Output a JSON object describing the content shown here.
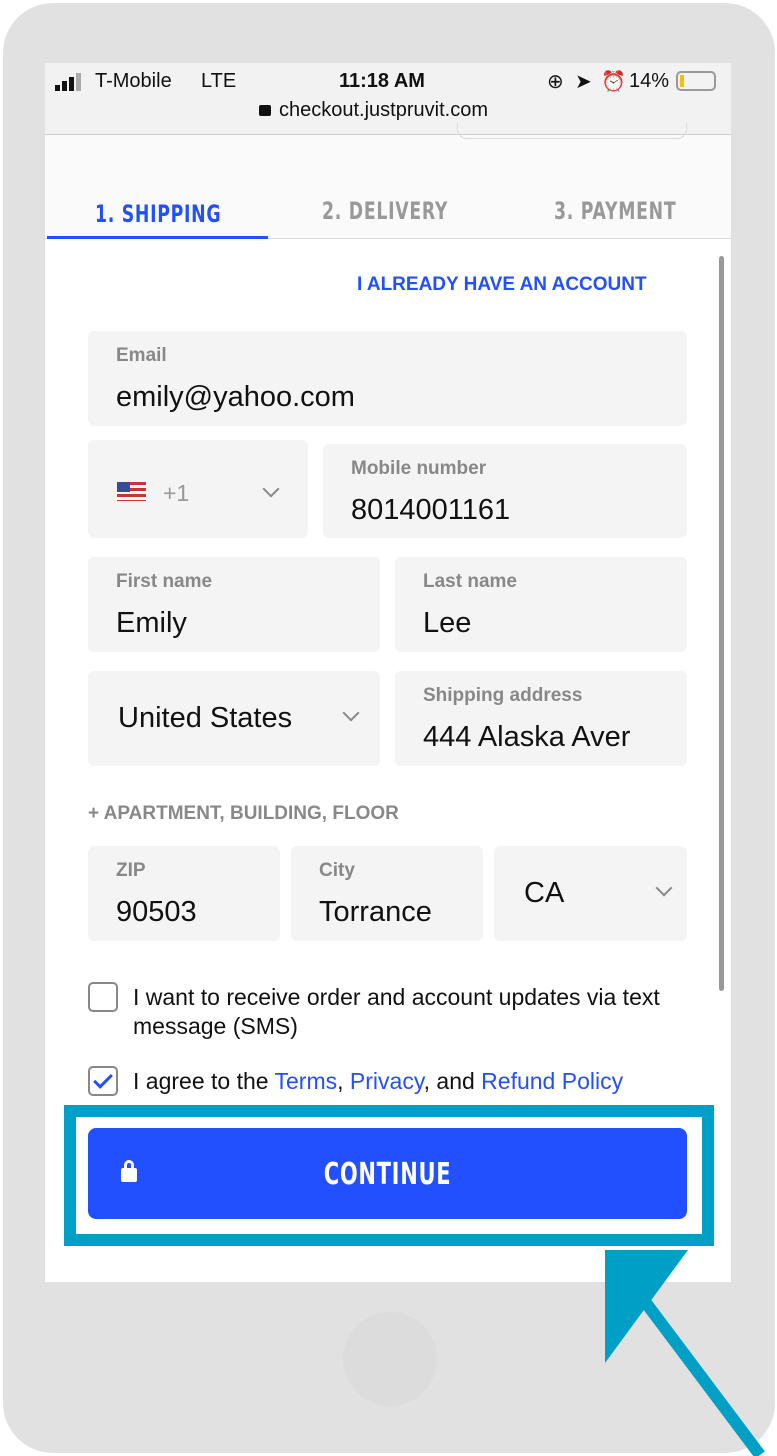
{
  "status_bar": {
    "carrier": "T-Mobile",
    "network": "LTE",
    "time": "11:18 AM",
    "battery": "14%",
    "url": "checkout.justpruvit.com",
    "icons": [
      "signal-icon",
      "orientation-lock-icon",
      "location-icon",
      "alarm-icon",
      "battery-icon",
      "lock-icon"
    ]
  },
  "tabs": [
    {
      "label": "1. SHIPPING",
      "active": true
    },
    {
      "label": "2. DELIVERY",
      "active": false
    },
    {
      "label": "3. PAYMENT",
      "active": false
    }
  ],
  "account_link": "I ALREADY HAVE AN ACCOUNT",
  "form": {
    "email": {
      "label": "Email",
      "value": "emily@yahoo.com"
    },
    "country_code": {
      "value": "+1",
      "flag": "us-flag-icon"
    },
    "mobile": {
      "label": "Mobile number",
      "value": "8014001161"
    },
    "first_name": {
      "label": "First name",
      "value": "Emily"
    },
    "last_name": {
      "label": "Last name",
      "value": "Lee"
    },
    "country": {
      "value": "United States"
    },
    "address": {
      "label": "Shipping address",
      "value": "444 Alaska Aver"
    },
    "apartment_link": "+ APARTMENT, BUILDING, FLOOR",
    "zip": {
      "label": "ZIP",
      "value": "90503"
    },
    "city": {
      "label": "City",
      "value": "Torrance"
    },
    "state": {
      "value": "CA"
    }
  },
  "sms_checkbox": {
    "checked": false,
    "label": "I want to receive order and account updates via text message (SMS)"
  },
  "agree_checkbox": {
    "checked": true,
    "prefix": "I agree to the ",
    "terms": "Terms",
    "sep1": ", ",
    "privacy": "Privacy",
    "sep2": ", and ",
    "refund": "Refund Policy"
  },
  "continue_button": "CONTINUE",
  "colors": {
    "accent": "#2350ff",
    "highlight": "#00a0c6"
  }
}
